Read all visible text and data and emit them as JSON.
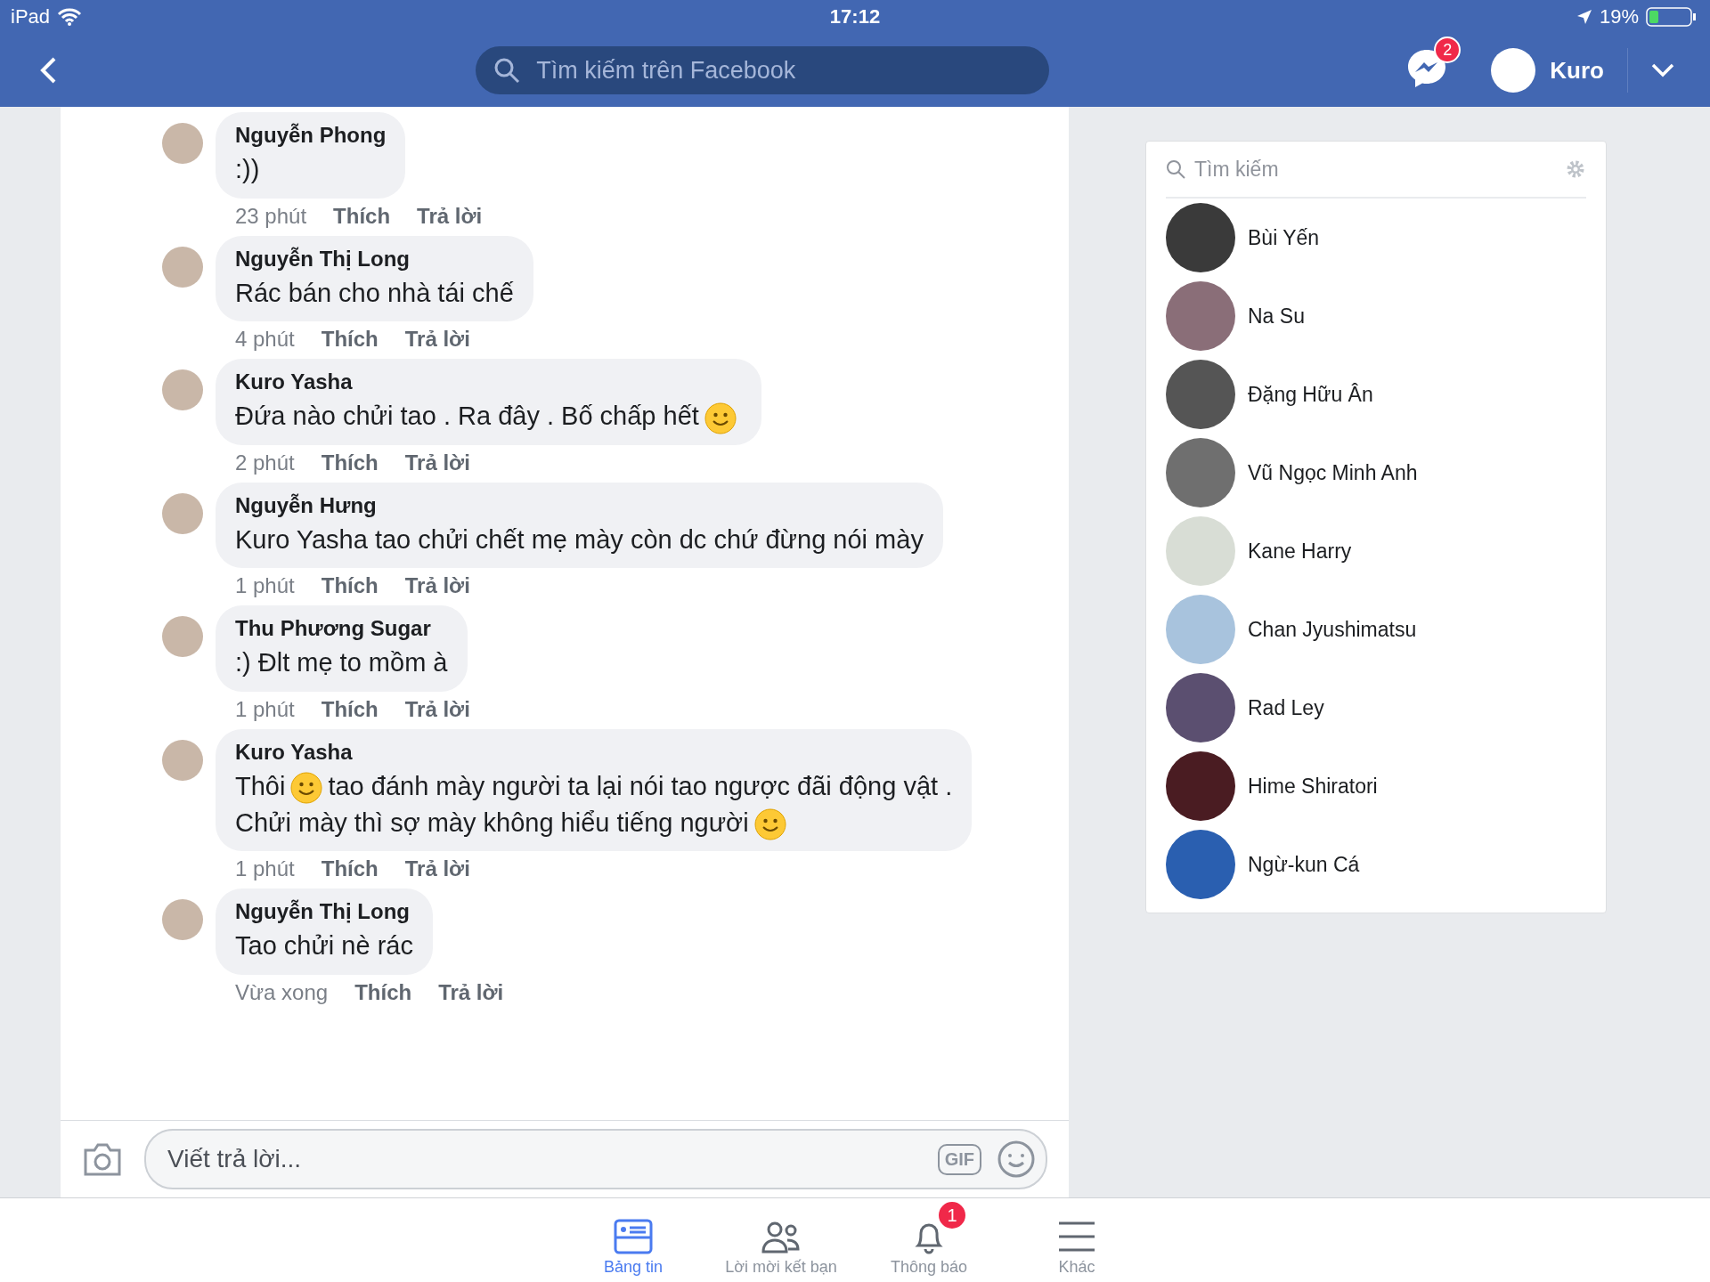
{
  "status_bar": {
    "device": "iPad",
    "time": "17:12",
    "battery": "19%"
  },
  "header": {
    "search_placeholder": "Tìm kiếm trên Facebook",
    "messenger_badge": "2",
    "user_name": "Kuro"
  },
  "comments": [
    {
      "author": "Nguyễn Phong",
      "time": "23 phút",
      "like": "Thích",
      "reply": "Trả lời",
      "parts": [
        {
          "kind": "text",
          "text": ":))"
        }
      ]
    },
    {
      "author": "Nguyễn Thị Long",
      "time": "4 phút",
      "like": "Thích",
      "reply": "Trả lời",
      "parts": [
        {
          "kind": "text",
          "text": "Rác bán cho nhà tái chế"
        }
      ]
    },
    {
      "author": "Kuro Yasha",
      "time": "2 phút",
      "like": "Thích",
      "reply": "Trả lời",
      "parts": [
        {
          "kind": "text",
          "text": "Đứa nào chửi tao . Ra đây . Bố chấp hết"
        },
        {
          "kind": "emoji"
        }
      ]
    },
    {
      "author": "Nguyễn Hưng",
      "time": "1 phút",
      "like": "Thích",
      "reply": "Trả lời",
      "parts": [
        {
          "kind": "text",
          "text": "Kuro Yasha tao chửi chết mẹ mày còn dc chứ đừng nói mày"
        }
      ]
    },
    {
      "author": "Thu Phương Sugar",
      "time": "1 phút",
      "like": "Thích",
      "reply": "Trả lời",
      "parts": [
        {
          "kind": "text",
          "text": ":) Đlt mẹ to mồm à"
        }
      ]
    },
    {
      "author": "Kuro Yasha",
      "time": "1 phút",
      "like": "Thích",
      "reply": "Trả lời",
      "parts": [
        {
          "kind": "text",
          "text": "Thôi"
        },
        {
          "kind": "emoji"
        },
        {
          "kind": "text",
          "text": "tao đánh mày người ta lại nói tao ngược đãi động vật ."
        },
        {
          "kind": "break"
        },
        {
          "kind": "text",
          "text": "Chửi mày thì sợ mày không hiểu tiếng người"
        },
        {
          "kind": "emoji"
        }
      ]
    },
    {
      "author": "Nguyễn Thị Long",
      "time": "Vừa xong",
      "like": "Thích",
      "reply": "Trả lời",
      "parts": [
        {
          "kind": "text",
          "text": "Tao chửi nè rác"
        }
      ]
    }
  ],
  "composer": {
    "placeholder": "Viết trả lời...",
    "gif_label": "GIF"
  },
  "contacts": {
    "search_placeholder": "Tìm kiếm",
    "items": [
      "Bùi Yến",
      "Na Su",
      "Đặng Hữu Ân",
      "Vũ Ngọc Minh Anh",
      "Kane Harry",
      "Chan Jyushimatsu",
      "Rad Ley",
      "Hime Shiratori",
      "Ngừ-kun Cá"
    ]
  },
  "tab_bar": [
    {
      "kind": "news",
      "label": "Bảng tin",
      "selected": true
    },
    {
      "kind": "friends",
      "label": "Lời mời kết bạn",
      "selected": false
    },
    {
      "kind": "bell",
      "label": "Thông báo",
      "selected": false,
      "badge": "1"
    },
    {
      "kind": "menu",
      "label": "Khác",
      "selected": false
    }
  ]
}
